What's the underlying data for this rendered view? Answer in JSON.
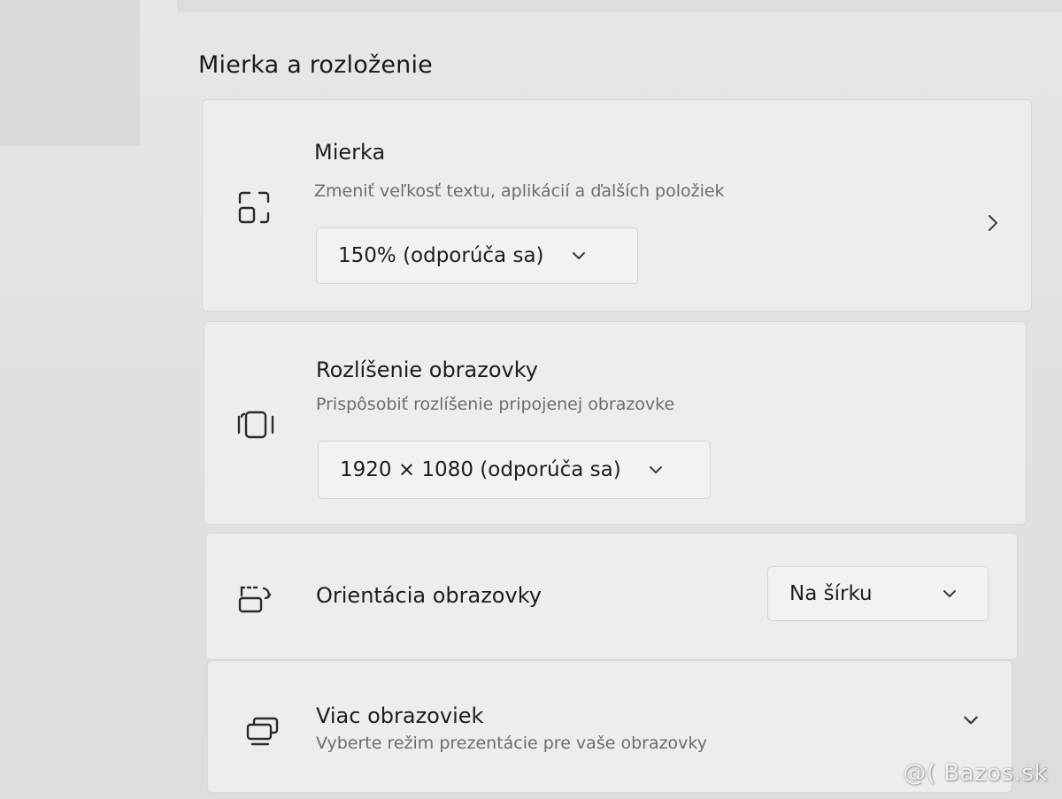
{
  "section": {
    "title": "Mierka a rozloženie"
  },
  "scale": {
    "title": "Mierka",
    "subtitle": "Zmeniť veľkosť textu, aplikácií a ďalších položiek",
    "value": "150% (odporúča sa)",
    "icon": "scale-icon"
  },
  "resolution": {
    "title": "Rozlíšenie obrazovky",
    "subtitle": "Prispôsobiť rozlíšenie pripojenej obrazovke",
    "value": "1920 × 1080 (odporúča sa)",
    "icon": "resolution-icon"
  },
  "orientation": {
    "title": "Orientácia obrazovky",
    "value": "Na šírku",
    "icon": "orientation-icon"
  },
  "multiple_displays": {
    "title": "Viac obrazoviek",
    "subtitle": "Vyberte režim prezentácie pre vaše obrazovky",
    "icon": "multiple-displays-icon"
  },
  "watermark": "@( Bazos.sk",
  "colors": {
    "background": "#e3e5e4",
    "card": "#eceeed",
    "text_primary": "#1d1f1f",
    "text_secondary": "#6b6e6e"
  }
}
